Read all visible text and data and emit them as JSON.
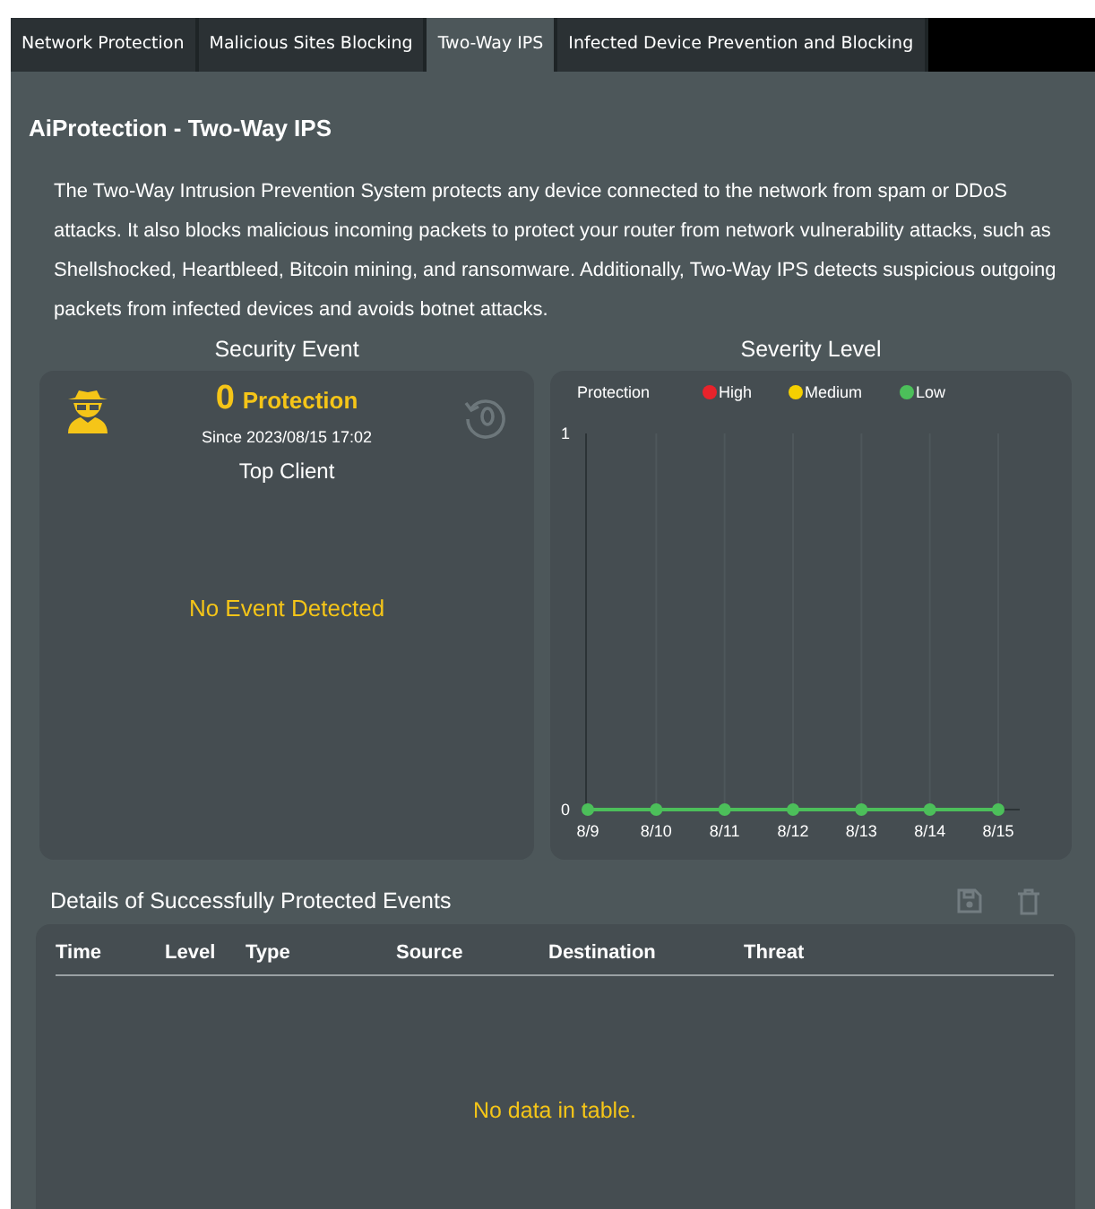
{
  "tabs": [
    {
      "label": "Network Protection",
      "selected": false
    },
    {
      "label": "Malicious Sites Blocking",
      "selected": false
    },
    {
      "label": "Two-Way IPS",
      "selected": true
    },
    {
      "label": "Infected Device Prevention and Blocking",
      "selected": false
    }
  ],
  "title": "AiProtection - Two-Way IPS",
  "description": "The Two-Way Intrusion Prevention System protects any device connected to the network from spam or DDoS attacks. It also blocks malicious incoming packets to protect your router from network vulnerability attacks, such as Shellshocked, Heartbleed, Bitcoin mining, and ransomware. Additionally, Two-Way IPS detects suspicious outgoing packets from infected devices and avoids botnet attacks.",
  "security_event": {
    "heading": "Security Event",
    "count": "0",
    "count_label": "Protection",
    "since": "Since 2023/08/15 17:02",
    "top_client": "Top Client",
    "empty_message": "No Event Detected"
  },
  "severity_level": {
    "heading": "Severity Level",
    "chart_data": {
      "type": "line",
      "title": "Protection",
      "categories": [
        "8/9",
        "8/10",
        "8/11",
        "8/12",
        "8/13",
        "8/14",
        "8/15"
      ],
      "series": [
        {
          "name": "High",
          "color": "#e8232b",
          "values": [
            null,
            null,
            null,
            null,
            null,
            null,
            null
          ]
        },
        {
          "name": "Medium",
          "color": "#f5d000",
          "values": [
            null,
            null,
            null,
            null,
            null,
            null,
            null
          ]
        },
        {
          "name": "Low",
          "color": "#4cbf5a",
          "marker": "circle",
          "values": [
            0,
            0,
            0,
            0,
            0,
            0,
            0
          ]
        }
      ],
      "ylim": [
        0,
        1
      ],
      "yticks": [
        0,
        1
      ],
      "grid": true
    }
  },
  "details": {
    "title": "Details of Successfully Protected Events",
    "columns": [
      "Time",
      "Level",
      "Type",
      "Source",
      "Destination",
      "Threat"
    ],
    "empty_message": "No data in table."
  }
}
